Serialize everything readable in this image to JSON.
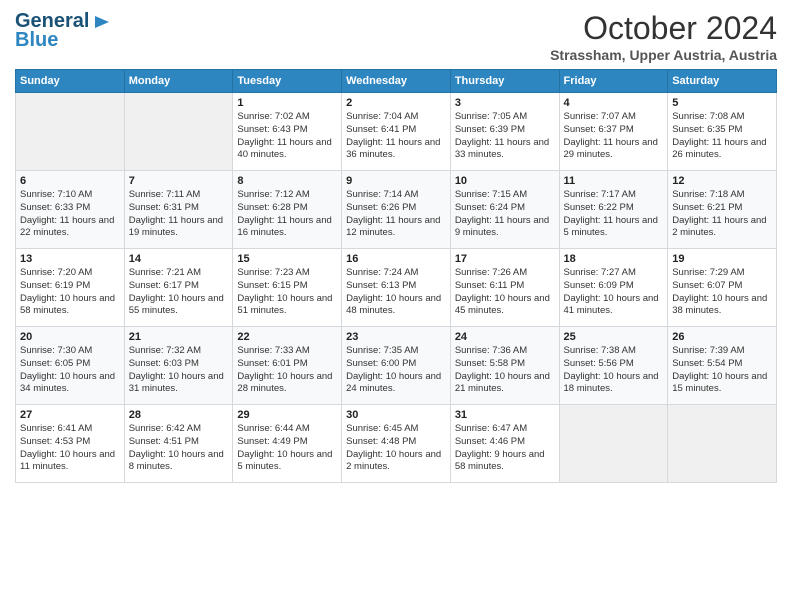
{
  "header": {
    "logo_line1": "General",
    "logo_line2": "Blue",
    "month": "October 2024",
    "location": "Strassham, Upper Austria, Austria"
  },
  "days_of_week": [
    "Sunday",
    "Monday",
    "Tuesday",
    "Wednesday",
    "Thursday",
    "Friday",
    "Saturday"
  ],
  "weeks": [
    [
      {
        "day": "",
        "content": ""
      },
      {
        "day": "",
        "content": ""
      },
      {
        "day": "1",
        "content": "Sunrise: 7:02 AM\nSunset: 6:43 PM\nDaylight: 11 hours and 40 minutes."
      },
      {
        "day": "2",
        "content": "Sunrise: 7:04 AM\nSunset: 6:41 PM\nDaylight: 11 hours and 36 minutes."
      },
      {
        "day": "3",
        "content": "Sunrise: 7:05 AM\nSunset: 6:39 PM\nDaylight: 11 hours and 33 minutes."
      },
      {
        "day": "4",
        "content": "Sunrise: 7:07 AM\nSunset: 6:37 PM\nDaylight: 11 hours and 29 minutes."
      },
      {
        "day": "5",
        "content": "Sunrise: 7:08 AM\nSunset: 6:35 PM\nDaylight: 11 hours and 26 minutes."
      }
    ],
    [
      {
        "day": "6",
        "content": "Sunrise: 7:10 AM\nSunset: 6:33 PM\nDaylight: 11 hours and 22 minutes."
      },
      {
        "day": "7",
        "content": "Sunrise: 7:11 AM\nSunset: 6:31 PM\nDaylight: 11 hours and 19 minutes."
      },
      {
        "day": "8",
        "content": "Sunrise: 7:12 AM\nSunset: 6:28 PM\nDaylight: 11 hours and 16 minutes."
      },
      {
        "day": "9",
        "content": "Sunrise: 7:14 AM\nSunset: 6:26 PM\nDaylight: 11 hours and 12 minutes."
      },
      {
        "day": "10",
        "content": "Sunrise: 7:15 AM\nSunset: 6:24 PM\nDaylight: 11 hours and 9 minutes."
      },
      {
        "day": "11",
        "content": "Sunrise: 7:17 AM\nSunset: 6:22 PM\nDaylight: 11 hours and 5 minutes."
      },
      {
        "day": "12",
        "content": "Sunrise: 7:18 AM\nSunset: 6:21 PM\nDaylight: 11 hours and 2 minutes."
      }
    ],
    [
      {
        "day": "13",
        "content": "Sunrise: 7:20 AM\nSunset: 6:19 PM\nDaylight: 10 hours and 58 minutes."
      },
      {
        "day": "14",
        "content": "Sunrise: 7:21 AM\nSunset: 6:17 PM\nDaylight: 10 hours and 55 minutes."
      },
      {
        "day": "15",
        "content": "Sunrise: 7:23 AM\nSunset: 6:15 PM\nDaylight: 10 hours and 51 minutes."
      },
      {
        "day": "16",
        "content": "Sunrise: 7:24 AM\nSunset: 6:13 PM\nDaylight: 10 hours and 48 minutes."
      },
      {
        "day": "17",
        "content": "Sunrise: 7:26 AM\nSunset: 6:11 PM\nDaylight: 10 hours and 45 minutes."
      },
      {
        "day": "18",
        "content": "Sunrise: 7:27 AM\nSunset: 6:09 PM\nDaylight: 10 hours and 41 minutes."
      },
      {
        "day": "19",
        "content": "Sunrise: 7:29 AM\nSunset: 6:07 PM\nDaylight: 10 hours and 38 minutes."
      }
    ],
    [
      {
        "day": "20",
        "content": "Sunrise: 7:30 AM\nSunset: 6:05 PM\nDaylight: 10 hours and 34 minutes."
      },
      {
        "day": "21",
        "content": "Sunrise: 7:32 AM\nSunset: 6:03 PM\nDaylight: 10 hours and 31 minutes."
      },
      {
        "day": "22",
        "content": "Sunrise: 7:33 AM\nSunset: 6:01 PM\nDaylight: 10 hours and 28 minutes."
      },
      {
        "day": "23",
        "content": "Sunrise: 7:35 AM\nSunset: 6:00 PM\nDaylight: 10 hours and 24 minutes."
      },
      {
        "day": "24",
        "content": "Sunrise: 7:36 AM\nSunset: 5:58 PM\nDaylight: 10 hours and 21 minutes."
      },
      {
        "day": "25",
        "content": "Sunrise: 7:38 AM\nSunset: 5:56 PM\nDaylight: 10 hours and 18 minutes."
      },
      {
        "day": "26",
        "content": "Sunrise: 7:39 AM\nSunset: 5:54 PM\nDaylight: 10 hours and 15 minutes."
      }
    ],
    [
      {
        "day": "27",
        "content": "Sunrise: 6:41 AM\nSunset: 4:53 PM\nDaylight: 10 hours and 11 minutes."
      },
      {
        "day": "28",
        "content": "Sunrise: 6:42 AM\nSunset: 4:51 PM\nDaylight: 10 hours and 8 minutes."
      },
      {
        "day": "29",
        "content": "Sunrise: 6:44 AM\nSunset: 4:49 PM\nDaylight: 10 hours and 5 minutes."
      },
      {
        "day": "30",
        "content": "Sunrise: 6:45 AM\nSunset: 4:48 PM\nDaylight: 10 hours and 2 minutes."
      },
      {
        "day": "31",
        "content": "Sunrise: 6:47 AM\nSunset: 4:46 PM\nDaylight: 9 hours and 58 minutes."
      },
      {
        "day": "",
        "content": ""
      },
      {
        "day": "",
        "content": ""
      }
    ]
  ]
}
